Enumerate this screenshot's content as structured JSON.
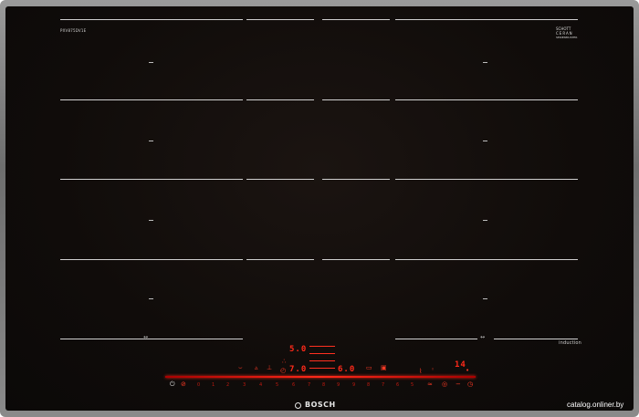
{
  "product": {
    "model_text": "PXV875DV1E",
    "glass_brand_line1": "SCHOTT",
    "glass_brand_line2": "CERAN",
    "glass_brand_line3": "SERIENMUSTER",
    "induction_label": "induction",
    "brand": "BOSCH",
    "flex_label_left": "↔",
    "flex_label_right": "↔"
  },
  "display": {
    "top_readout": "5.0",
    "middle_readout": "7.0",
    "right_readout": "6.0",
    "timer_readout": "14"
  },
  "slider": {
    "scale": [
      "0",
      "1",
      "2",
      "3",
      "4",
      "5",
      "6",
      "7",
      "8",
      "9"
    ],
    "scale_right": [
      "9",
      "8",
      "7",
      "6",
      "5",
      "4",
      "3",
      "2",
      "1",
      "0"
    ]
  },
  "watermark": "catalog.onliner.by",
  "colors": {
    "glass": "#100c0a",
    "frame": "#8a8a8a",
    "display_red": "#ff2a1a"
  }
}
